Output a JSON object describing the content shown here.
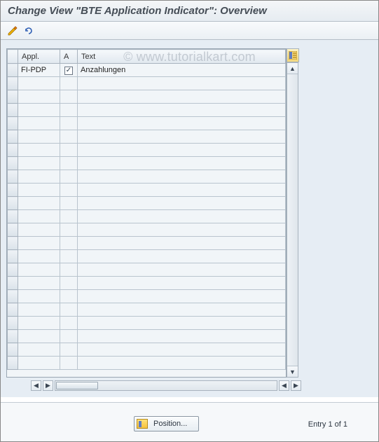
{
  "title": "Change View \"BTE Application Indicator\": Overview",
  "watermark": "© www.tutorialkart.com",
  "toolbar": {
    "edit_icon": "edit-pencil",
    "undo_icon": "undo"
  },
  "grid": {
    "columns": {
      "appl": "Appl.",
      "active": "A",
      "text": "Text"
    },
    "rows": [
      {
        "appl": "FI-PDP",
        "active": true,
        "text": "Anzahlungen"
      }
    ],
    "empty_row_count": 22
  },
  "footer": {
    "position_label": "Position...",
    "entry_text": "Entry 1 of 1"
  }
}
